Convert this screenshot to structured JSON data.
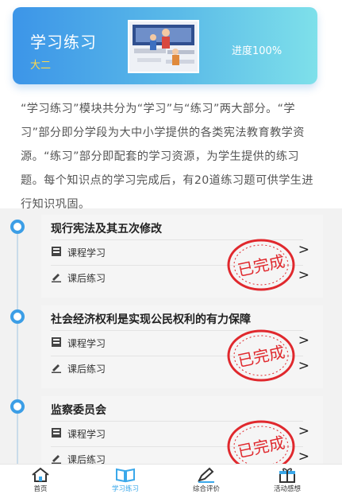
{
  "banner": {
    "title": "学习练习",
    "subtitle": "大二",
    "progress": "进度100%"
  },
  "description": "“学习练习”模块共分为“学习”与“练习”两大部分。“学习”部分即分学段为大中小学提供的各类宪法教育教学资源。“练习”部分即配套的学习资源，为学生提供的练习题。每个知识点的学习完成后，有20道练习题可供学生进行知识巩固。",
  "modules": [
    {
      "title": "现行宪法及其五次修改",
      "study_label": "课程学习",
      "practice_label": "课后练习",
      "stamp": "已完成"
    },
    {
      "title": "社会经济权利是实现公民权利的有力保障",
      "study_label": "课程学习",
      "practice_label": "课后练习",
      "stamp": "已完成"
    },
    {
      "title": "监察委员会",
      "study_label": "课程学习",
      "practice_label": "课后练习",
      "stamp": "已完成"
    }
  ],
  "tabs": [
    {
      "label": "首页",
      "icon": "home-icon"
    },
    {
      "label": "学习练习",
      "icon": "book-icon"
    },
    {
      "label": "综合评价",
      "icon": "edit-icon"
    },
    {
      "label": "活动感想",
      "icon": "gift-icon"
    }
  ],
  "colors": {
    "accent": "#3aa8ea",
    "stamp": "#e0282d",
    "highlight": "#ffd84a"
  }
}
